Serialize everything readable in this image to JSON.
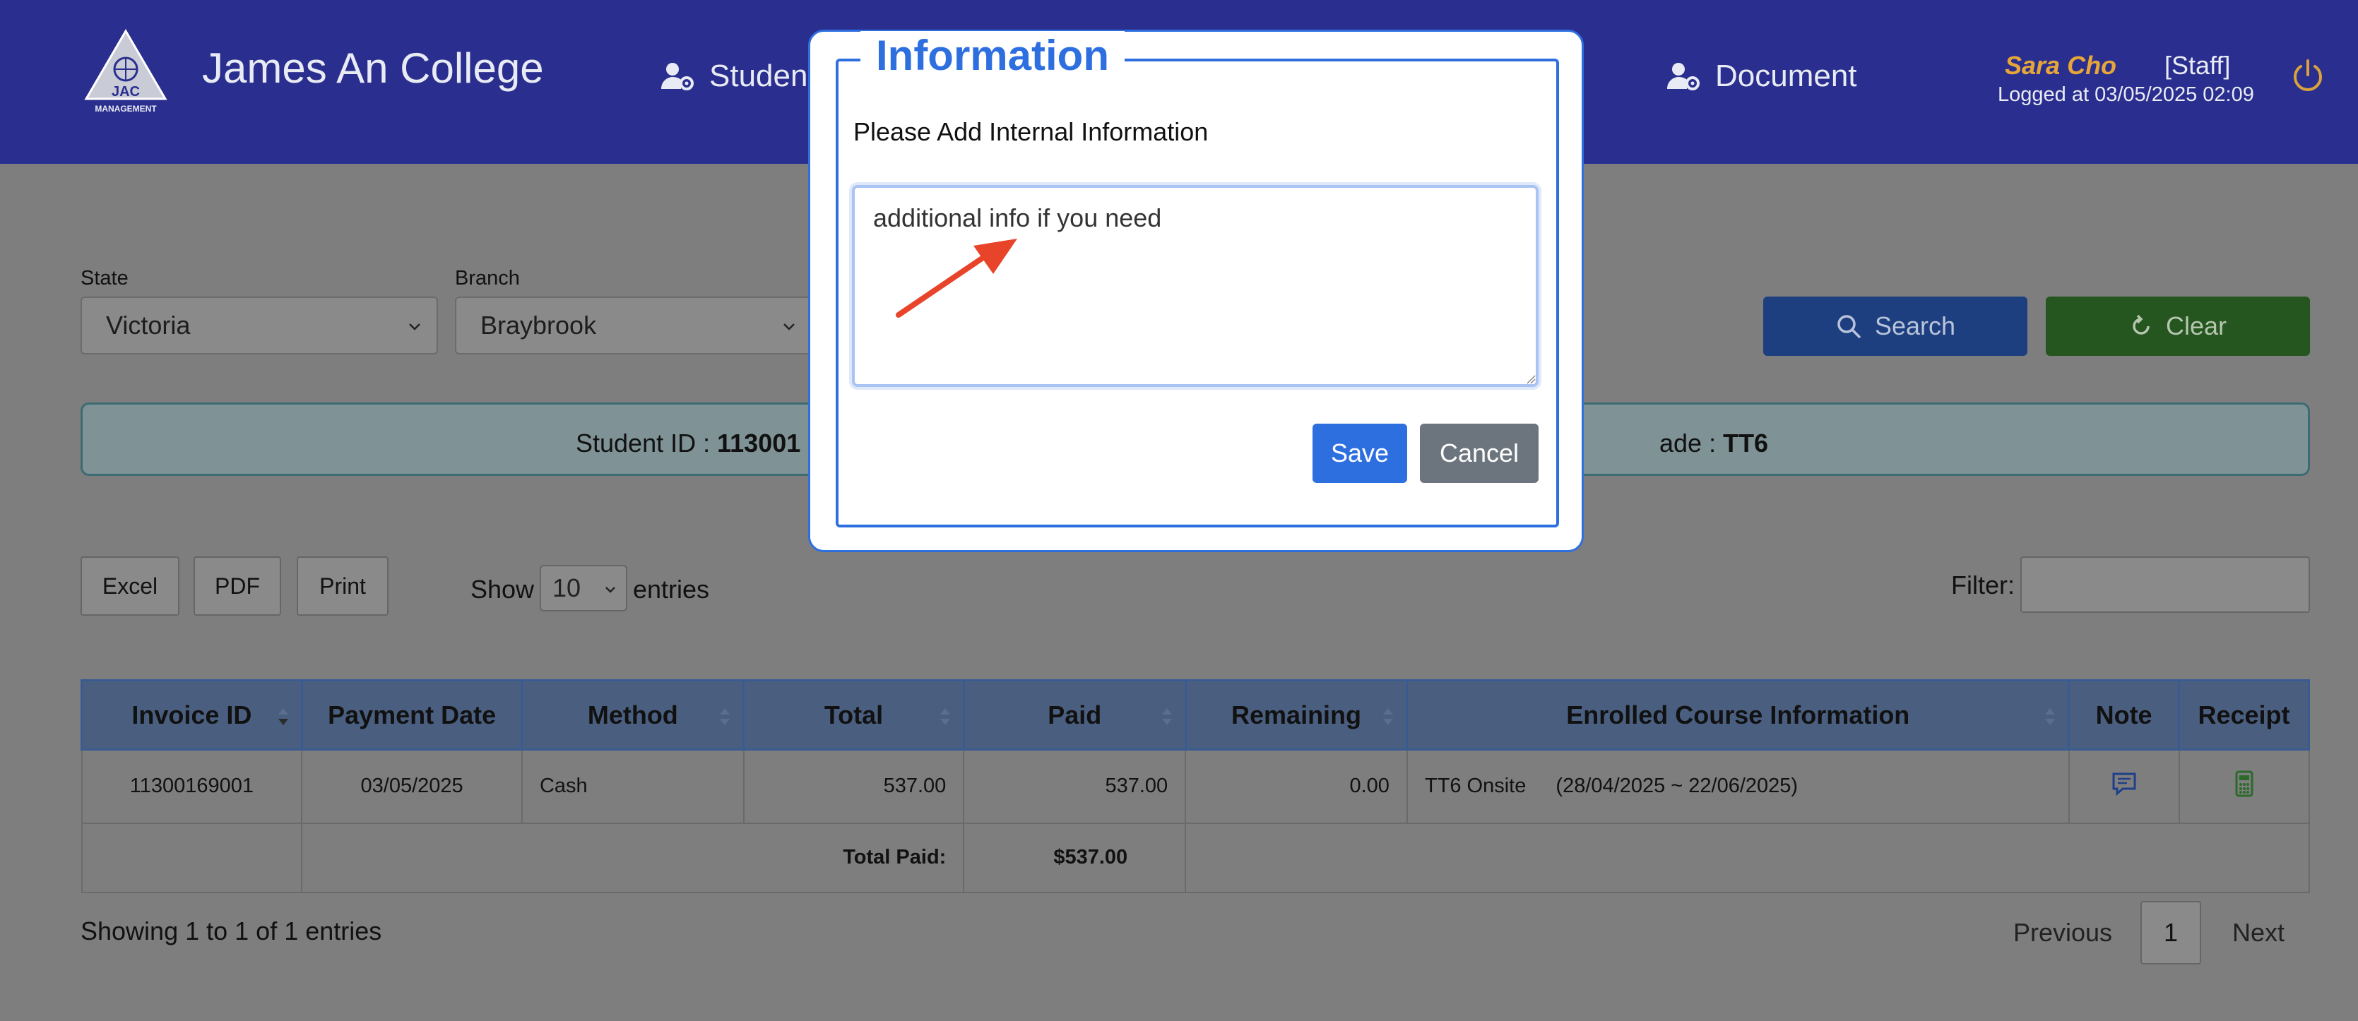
{
  "header": {
    "logo_text_top": "JAC",
    "logo_text_bottom": "MANAGEMENT",
    "brand": "James An College",
    "nav": [
      {
        "label": "Studen",
        "icon": "user-gear-icon"
      },
      {
        "label": "Document",
        "icon": "user-gear-icon"
      }
    ],
    "user_name": "Sara Cho",
    "user_role": "[Staff]",
    "logged_at": "Logged at 03/05/2025 02:09"
  },
  "filters": {
    "state_label": "State",
    "state_value": "Victoria",
    "branch_label": "Branch",
    "branch_value": "Braybrook",
    "search_label": "Search",
    "clear_label": "Clear"
  },
  "info_bar": {
    "student_id_label": "Student ID : ",
    "student_id_value": "113001",
    "grade_label": "ade : ",
    "grade_value": "TT6"
  },
  "toolbar": {
    "excel": "Excel",
    "pdf": "PDF",
    "print": "Print",
    "show_label": "Show",
    "entries_value": "10",
    "entries_label": "entries",
    "filter_label": "Filter:"
  },
  "table": {
    "headers": [
      "Invoice ID",
      "Payment Date",
      "Method",
      "Total",
      "Paid",
      "Remaining",
      "Enrolled Course Information",
      "Note",
      "Receipt"
    ],
    "rows": [
      {
        "invoice_id": "11300169001",
        "payment_date": "03/05/2025",
        "method": "Cash",
        "total": "537.00",
        "paid": "537.00",
        "remaining": "0.00",
        "course": "TT6 Onsite",
        "course_dates": "(28/04/2025 ~ 22/06/2025)"
      }
    ],
    "total_paid_label": "Total Paid:",
    "total_paid_value": "$537.00"
  },
  "footer": {
    "showing": "Showing 1 to 1 of 1 entries",
    "previous": "Previous",
    "page": "1",
    "next": "Next"
  },
  "modal": {
    "title": "Information",
    "subtitle": "Please Add Internal Information",
    "textarea_value": "additional info if you need",
    "save_label": "Save",
    "cancel_label": "Cancel"
  },
  "colors": {
    "header_bg": "#2a2f8f",
    "accent_blue": "#2e6fe0",
    "arrow_red": "#e8442a",
    "user_name": "#e6a63a"
  }
}
